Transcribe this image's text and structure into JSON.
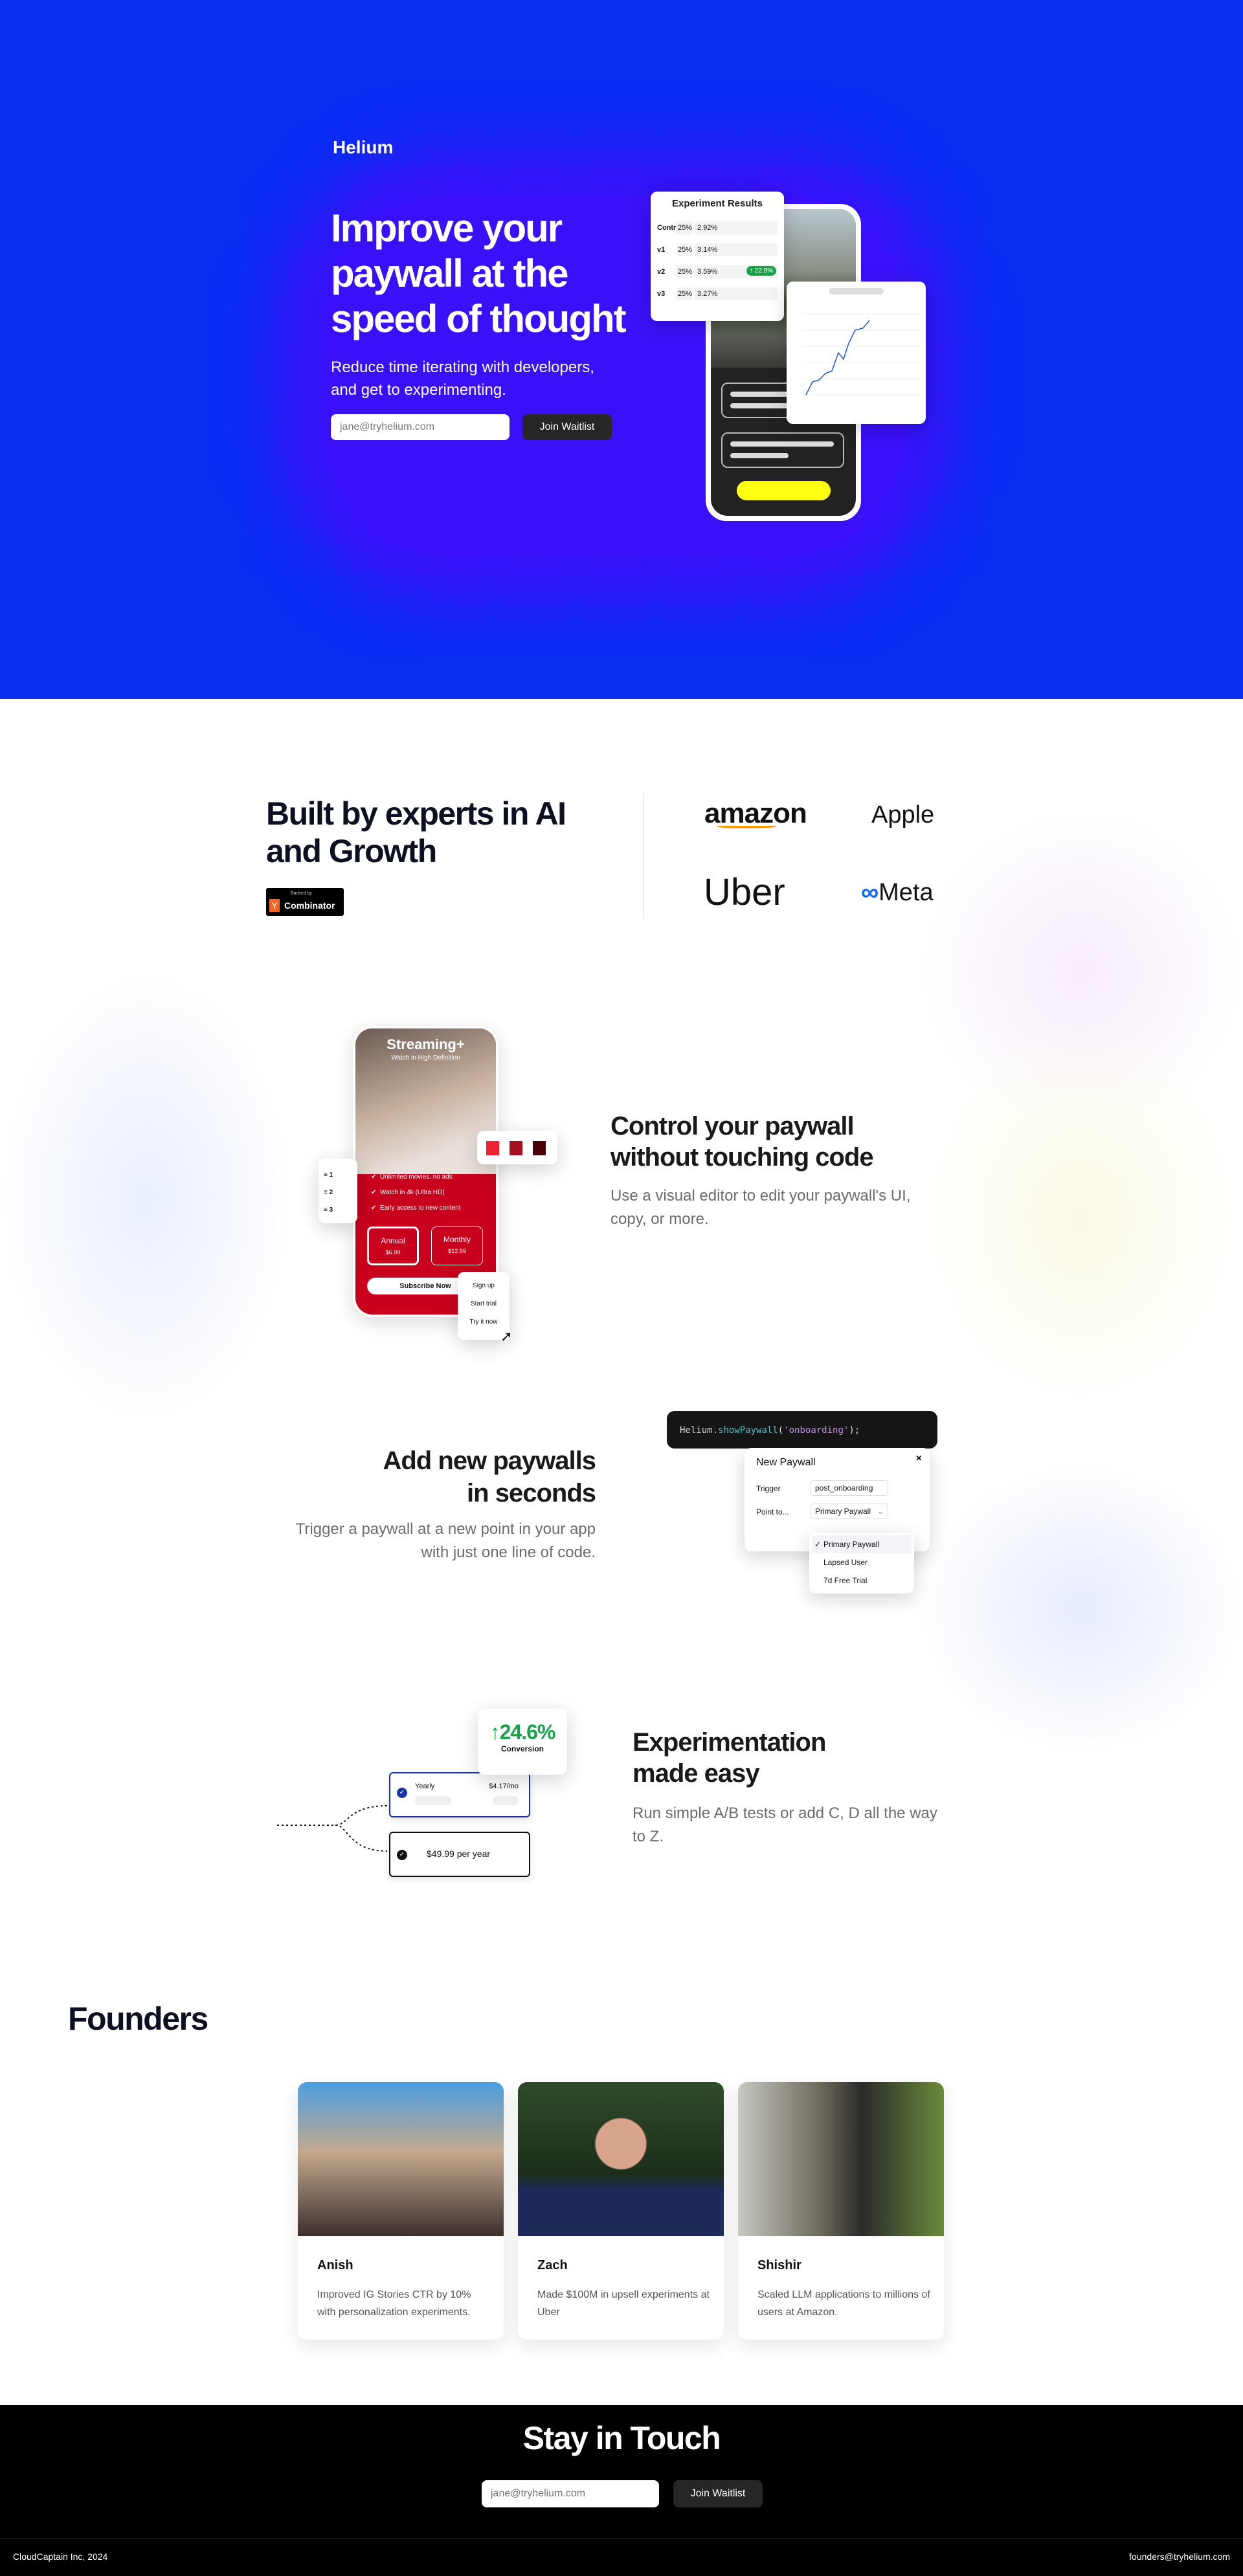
{
  "colors": {
    "hero_bg": "#0b2df2",
    "accent_purple": "#3a10f8",
    "button_dark": "#262626",
    "success": "#18a34a",
    "paywall_red": "#c8001e"
  },
  "hero": {
    "logo": "Helium",
    "title_lines": [
      "Improve your",
      "paywall at the",
      "speed of thought"
    ],
    "subtitle_lines": [
      "Reduce time iterating with developers,",
      "and get to experimenting."
    ],
    "email_placeholder": "jane@tryhelium.com",
    "cta": "Join Waitlist",
    "experiment": {
      "title": "Experiment Results",
      "rows": [
        {
          "name": "Control",
          "split": "25%",
          "rate": "2.92%"
        },
        {
          "name": "v1",
          "split": "25%",
          "rate": "3.14%"
        },
        {
          "name": "v2",
          "split": "25%",
          "rate": "3.59%",
          "lift": "↑ 22.9%"
        },
        {
          "name": "v3",
          "split": "25%",
          "rate": "3.27%"
        }
      ]
    }
  },
  "experts": {
    "title_lines": [
      "Built by experts in AI",
      "and Growth"
    ],
    "yc_backed": "Backed by",
    "yc_logo": "Y",
    "yc_name": "Combinator",
    "logos": [
      "amazon",
      "Apple",
      "Uber",
      "Meta"
    ]
  },
  "feature1": {
    "title_lines": [
      "Control your paywall",
      "without touching code"
    ],
    "desc_lines": [
      "Use a visual editor to edit your paywall's UI,",
      "copy, or more."
    ],
    "mock": {
      "app": "Streaming+",
      "tagline": "Watch in High Definition",
      "benefits": [
        "Unlimited movies, no ads",
        "Watch in 4k (Ultra HD)",
        "Early access to new content"
      ],
      "plans": [
        {
          "name": "Annual",
          "price": "$6.99"
        },
        {
          "name": "Monthly",
          "price": "$12.99"
        }
      ],
      "cta": "Subscribe Now",
      "cta_options": [
        "Sign up",
        "Start trial",
        "Try it now"
      ],
      "order": [
        "1",
        "2",
        "3"
      ],
      "swatches": [
        "#ee2233",
        "#a3101f",
        "#4a0008"
      ]
    }
  },
  "feature2": {
    "title_lines": [
      "Add new paywalls",
      "in seconds"
    ],
    "desc_lines": [
      "Trigger a paywall at a new point in your app",
      "with just one line of code."
    ],
    "code": {
      "obj": "Helium.",
      "method": "showPaywall",
      "open": "(",
      "arg": "'onboarding'",
      "close": ");"
    },
    "modal": {
      "title": "New Paywall",
      "close": "×",
      "trigger_label": "Trigger",
      "trigger_value": "post_onboarding",
      "point_label": "Point to...",
      "point_value": "Primary Paywall",
      "options": [
        "Primary Paywall",
        "Lapsed User",
        "7d Free Trial"
      ]
    }
  },
  "feature3": {
    "title_lines": [
      "Experimentation",
      "made easy"
    ],
    "desc_lines": [
      "Run simple A/B tests or add C, D all the way",
      "to Z."
    ],
    "lift": "24.6%",
    "lift_label": "Conversion",
    "plan_a": {
      "name": "Yearly",
      "price": "$4.17/mo"
    },
    "plan_b": "$49.99 per year"
  },
  "founders": {
    "title": "Founders",
    "people": [
      {
        "name": "Anish",
        "bio": "Improved IG Stories CTR by 10% with personalization experiments."
      },
      {
        "name": "Zach",
        "bio": "Made $100M in upsell experiments at Uber"
      },
      {
        "name": "Shishir",
        "bio": "Scaled LLM applications to millions of users at Amazon."
      }
    ]
  },
  "footer": {
    "title": "Stay in Touch",
    "email_placeholder": "jane@tryhelium.com",
    "cta": "Join Waitlist",
    "copyright": "CloudCaptain Inc, 2024",
    "email": "founders@tryhelium.com"
  }
}
